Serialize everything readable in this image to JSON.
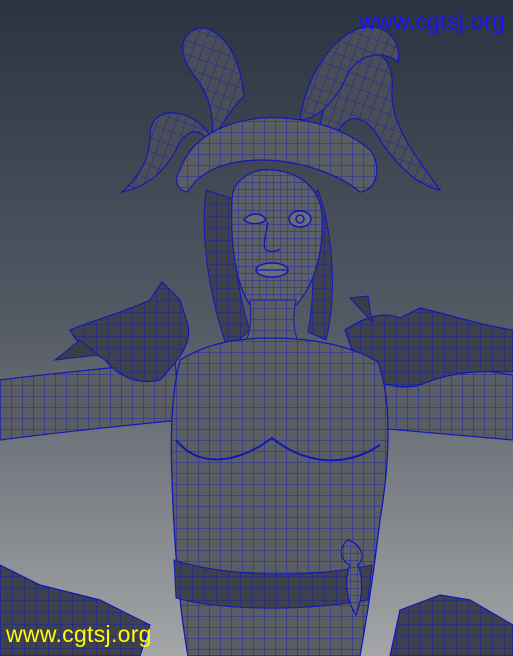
{
  "watermark_top": "www.cgtsj.org",
  "watermark_bottom": "www.cgtsj.org",
  "colors": {
    "background_top": "#2b3341",
    "background_bottom": "#a4a6a8",
    "surface": "#5a5d64",
    "surface_dark": "#3c3f47",
    "wireframe": "#1018b8",
    "watermark_top": "#1a12ff",
    "watermark_bottom": "#ffff00"
  },
  "subject": "character-wireframe"
}
